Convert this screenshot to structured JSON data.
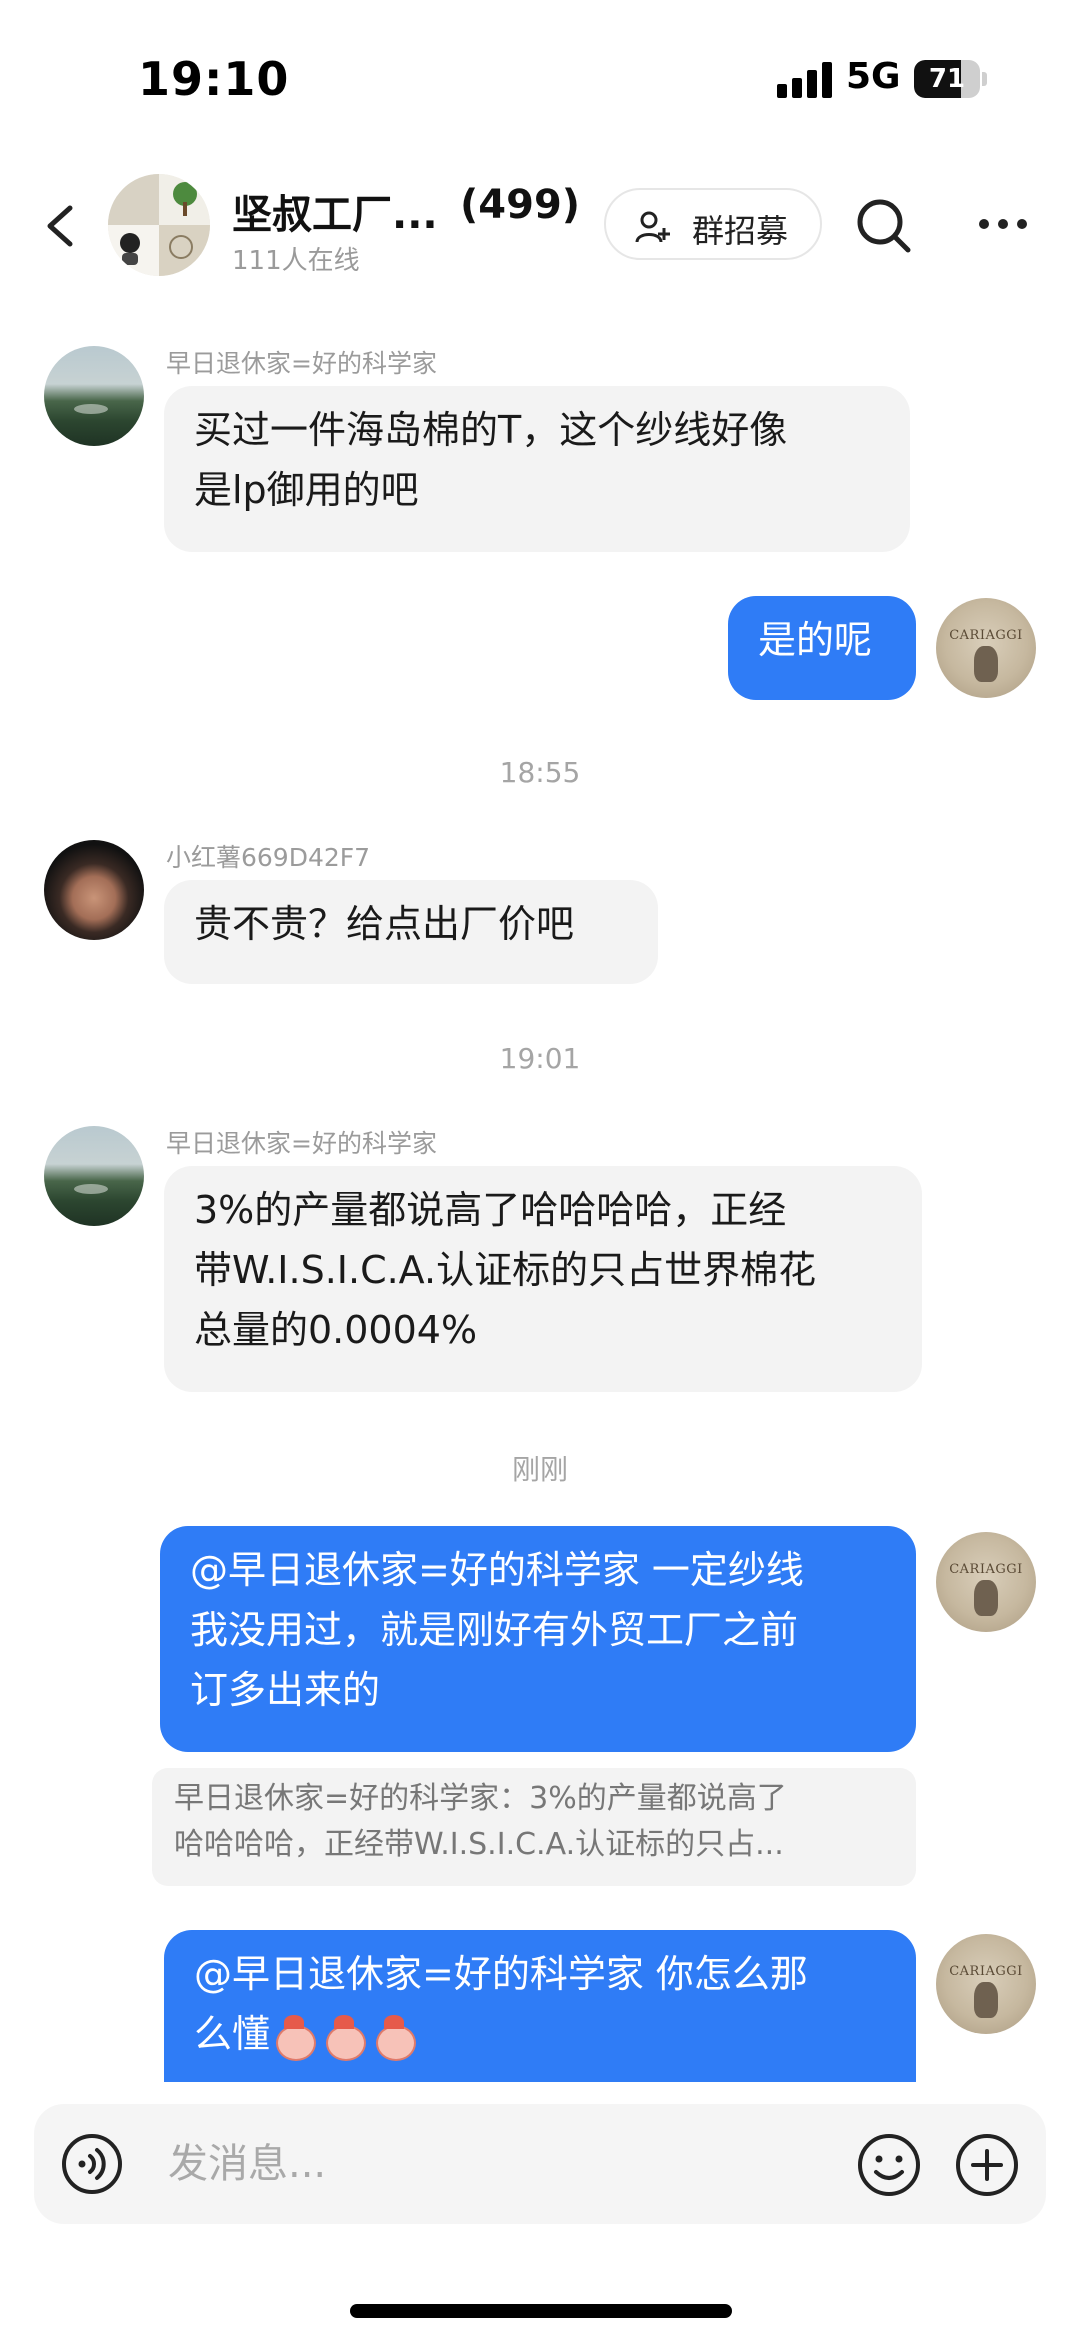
{
  "status_bar": {
    "time": "19:10",
    "network": "5G",
    "battery": "71",
    "battery_fraction": 0.71
  },
  "header": {
    "group_name": "坚叔工厂...",
    "member_count": "(499)",
    "online": "111人在线",
    "recruit_label": "群招募"
  },
  "messages": [
    {
      "sender": "早日退休家=好的科学家",
      "lines": [
        "买过一件海岛棉的T，这个纱线好像",
        "是lp御用的吧"
      ]
    },
    {
      "text": "是的呢"
    },
    {
      "time": "18:55"
    },
    {
      "sender": "小红薯669D42F7",
      "lines": [
        "贵不贵？给点出厂价吧"
      ]
    },
    {
      "time": "19:01"
    },
    {
      "sender": "早日退休家=好的科学家",
      "lines": [
        "3%的产量都说高了哈哈哈哈，正经",
        "带W.I.S.I.C.A.认证标的只占世界棉花",
        "总量的0.0004%"
      ]
    },
    {
      "time": "刚刚"
    },
    {
      "lines": [
        "@早日退休家=好的科学家 一定纱线",
        "我没用过，就是刚好有外贸工厂之前",
        "订多出来的"
      ],
      "quote": [
        "早日退休家=好的科学家：3%的产量都说高了",
        "哈哈哈哈，正经带W.I.S.I.C.A.认证标的只占..."
      ]
    },
    {
      "lines": [
        "@早日退休家=好的科学家 你怎么那",
        "么懂"
      ]
    }
  ],
  "own_avatar_label": "CARIAGGI",
  "input": {
    "placeholder": "发消息..."
  }
}
